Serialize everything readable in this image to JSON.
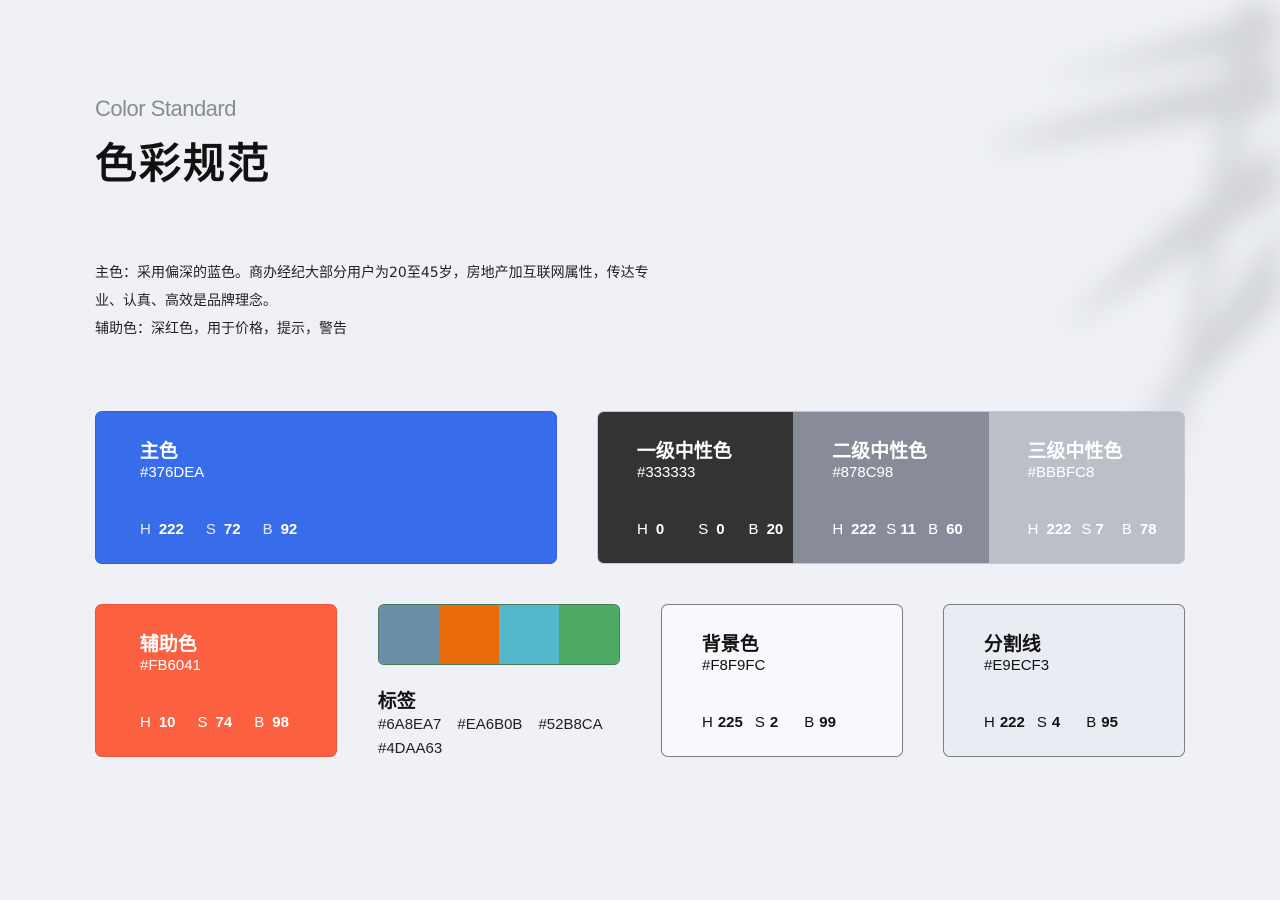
{
  "header": {
    "subtitle": "Color Standard",
    "title": "色彩规范"
  },
  "description": {
    "line1": "主色：采用偏深的蓝色。商办经纪大部分用户为20至45岁，房地产加互联网属性，传达专",
    "line2": "业、认真、高效是品牌理念。",
    "line3": "辅助色：深红色，用于价格，提示，警告"
  },
  "primary": {
    "label": "主色",
    "hex": "#376DEA",
    "h": "222",
    "s": "72",
    "b": "92",
    "color": "#376dea"
  },
  "neutrals": [
    {
      "label": "一级中性色",
      "hex": "#333333",
      "h": "0",
      "s": "0",
      "b": "20",
      "color": "#333333"
    },
    {
      "label": "二级中性色",
      "hex": "#878C98",
      "h": "222",
      "s": "11",
      "b": "60",
      "color": "#878c98"
    },
    {
      "label": "三级中性色",
      "hex": "#BBBFC8",
      "h": "222",
      "s": "7",
      "b": "78",
      "color": "#bbbfc8"
    }
  ],
  "accent": {
    "label": "辅助色",
    "hex": "#FB6041",
    "h": "10",
    "s": "74",
    "b": "98",
    "color": "#fb6041"
  },
  "tags": {
    "label": "标签",
    "colors": [
      {
        "hex": "#6A8EA7",
        "color": "#6a8ea7"
      },
      {
        "hex": "#EA6B0B",
        "color": "#ea6b0b"
      },
      {
        "hex": "#52B8CA",
        "color": "#52b8ca"
      },
      {
        "hex": "#4DAA63",
        "color": "#4daa63"
      }
    ]
  },
  "background": {
    "label": "背景色",
    "hex": "#F8F9FC",
    "h": "225",
    "s": "2",
    "b": "99",
    "color": "#f8f9fc"
  },
  "divider": {
    "label": "分割线",
    "hex": "#E9ECF3",
    "h": "222",
    "s": "4",
    "b": "95",
    "color": "#e9ecf3"
  },
  "hsb_keys": {
    "h": "H",
    "s": "S",
    "b": "B"
  }
}
